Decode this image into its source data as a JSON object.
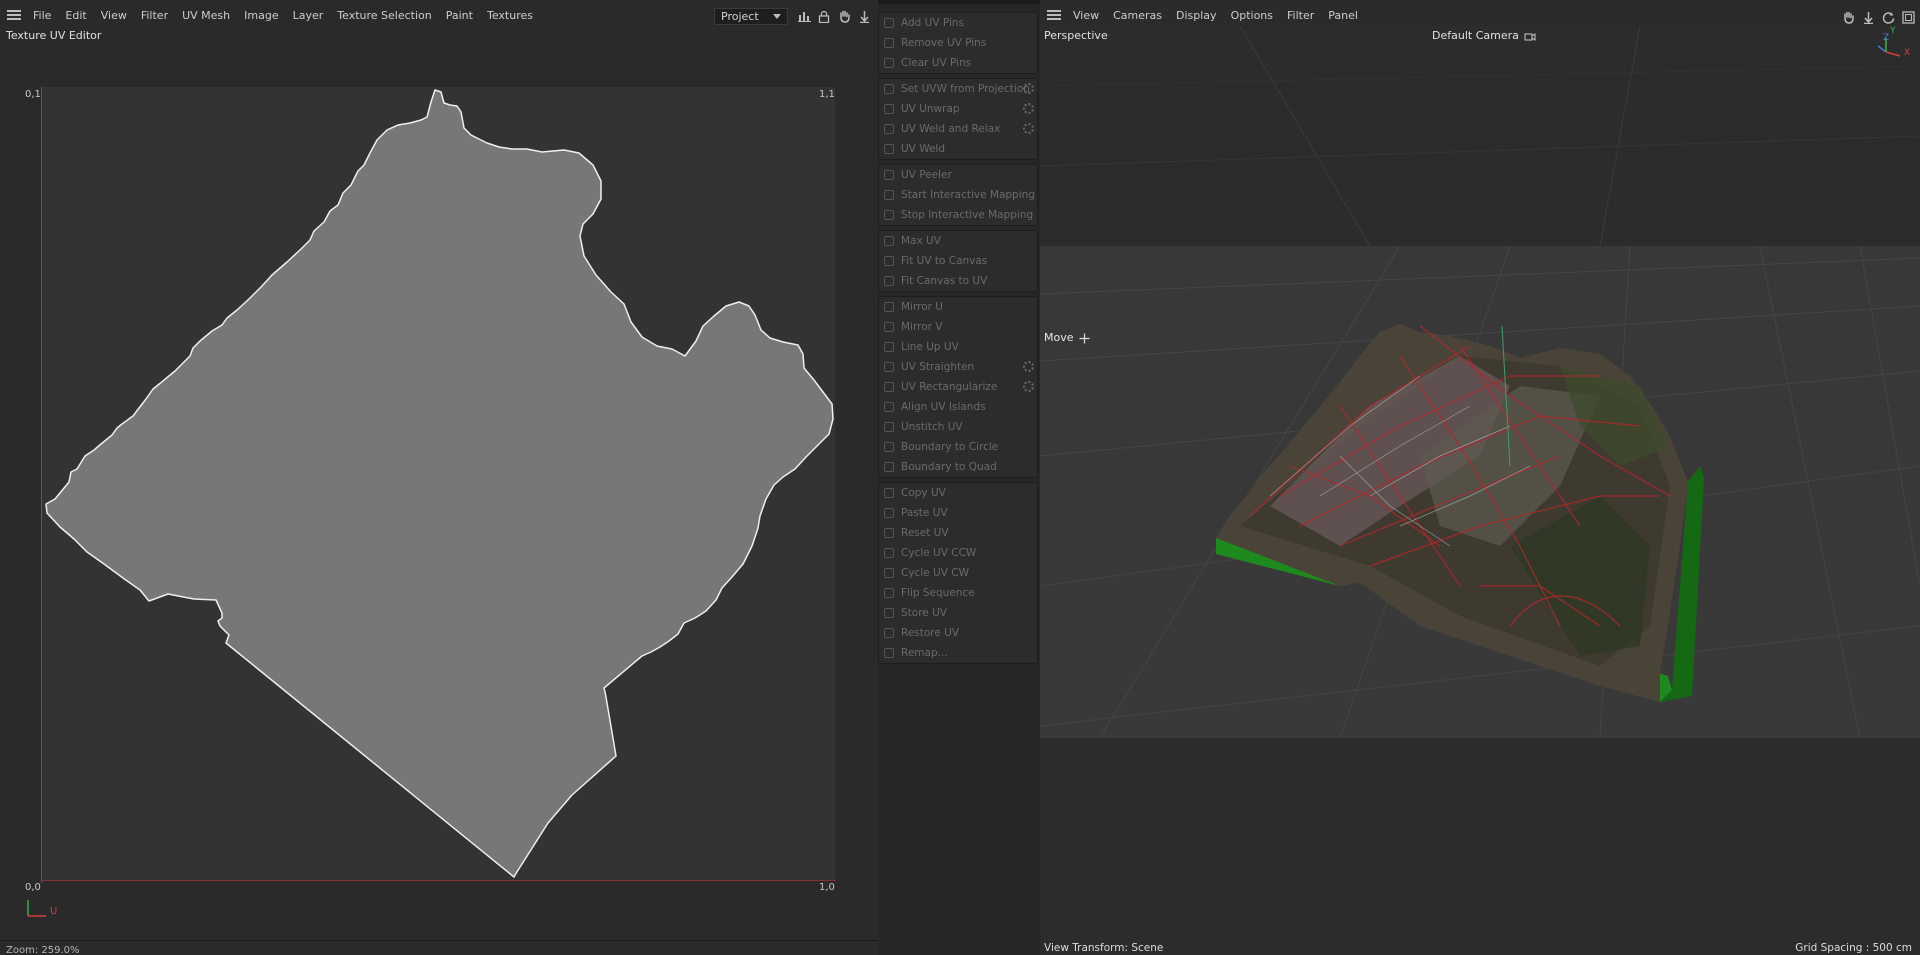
{
  "uv_editor": {
    "menu": [
      "File",
      "Edit",
      "View",
      "Filter",
      "UV Mesh",
      "Image",
      "Layer",
      "Texture Selection",
      "Paint",
      "Textures"
    ],
    "project_select": "Project",
    "panel_title": "Texture UV Editor",
    "corner_labels": {
      "top_left": "0,1",
      "top_right": "1,1",
      "bottom_left": "0,0",
      "bottom_right": "1,0"
    },
    "axis_u_label": "U",
    "zoom_status": "Zoom: 259.0%"
  },
  "commands": {
    "groups": [
      [
        {
          "label": "Add UV Pins",
          "icon": "pin-add-icon"
        },
        {
          "label": "Remove UV Pins",
          "icon": "pin-remove-icon"
        },
        {
          "label": "Clear UV Pins",
          "icon": "pin-clear-icon"
        }
      ],
      [
        {
          "label": "Set UVW from Projection",
          "icon": "projection-icon",
          "gear": true
        },
        {
          "label": "UV Unwrap",
          "icon": "unwrap-icon",
          "gear": true
        },
        {
          "label": "UV Weld and Relax",
          "icon": "weld-relax-icon",
          "gear": true
        },
        {
          "label": "UV Weld",
          "icon": "weld-icon"
        }
      ],
      [
        {
          "label": "UV Peeler",
          "icon": "peeler-icon"
        },
        {
          "label": "Start Interactive Mapping",
          "icon": "play-icon"
        },
        {
          "label": "Stop Interactive Mapping",
          "icon": "stop-icon"
        }
      ],
      [
        {
          "label": "Max UV",
          "icon": "max-uv-icon"
        },
        {
          "label": "Fit UV to Canvas",
          "icon": "fit-uv-icon"
        },
        {
          "label": "Fit Canvas to UV",
          "icon": "fit-canvas-icon"
        }
      ],
      [
        {
          "label": "Mirror U",
          "icon": "mirror-u-icon"
        },
        {
          "label": "Mirror V",
          "icon": "mirror-v-icon"
        },
        {
          "label": "Line Up UV",
          "icon": "line-up-icon"
        },
        {
          "label": "UV Straighten",
          "icon": "straighten-icon",
          "gear": true
        },
        {
          "label": "UV Rectangularize",
          "icon": "rectangularize-icon",
          "gear": true
        },
        {
          "label": "Align UV Islands",
          "icon": "align-icon"
        },
        {
          "label": "Unstitch UV",
          "icon": "unstitch-icon"
        },
        {
          "label": "Boundary to Circle",
          "icon": "circle-icon"
        },
        {
          "label": "Boundary to Quad",
          "icon": "quad-icon"
        }
      ],
      [
        {
          "label": "Copy UV",
          "icon": "copy-icon"
        },
        {
          "label": "Paste UV",
          "icon": "paste-icon"
        },
        {
          "label": "Reset UV",
          "icon": "reset-icon"
        },
        {
          "label": "Cycle UV CCW",
          "icon": "cycle-ccw-icon"
        },
        {
          "label": "Cycle UV CW",
          "icon": "cycle-cw-icon"
        },
        {
          "label": "Flip Sequence",
          "icon": "flip-icon"
        },
        {
          "label": "Store UV",
          "icon": "store-icon"
        },
        {
          "label": "Restore UV",
          "icon": "restore-icon"
        },
        {
          "label": "Remap...",
          "icon": "remap-icon"
        }
      ]
    ]
  },
  "viewport": {
    "menu": [
      "View",
      "Cameras",
      "Display",
      "Options",
      "Filter",
      "Panel"
    ],
    "view_name": "Perspective",
    "camera_name": "Default Camera",
    "active_tool": "Move",
    "view_transform": "View Transform: Scene",
    "grid_spacing": "Grid Spacing : 500 cm",
    "axis_labels": {
      "x": "X",
      "y": "Y",
      "z": "Z"
    },
    "colors": {
      "terrain_side": "#1e8a1e",
      "road_lines": "#b3262a",
      "uv_fill": "#777777"
    }
  }
}
